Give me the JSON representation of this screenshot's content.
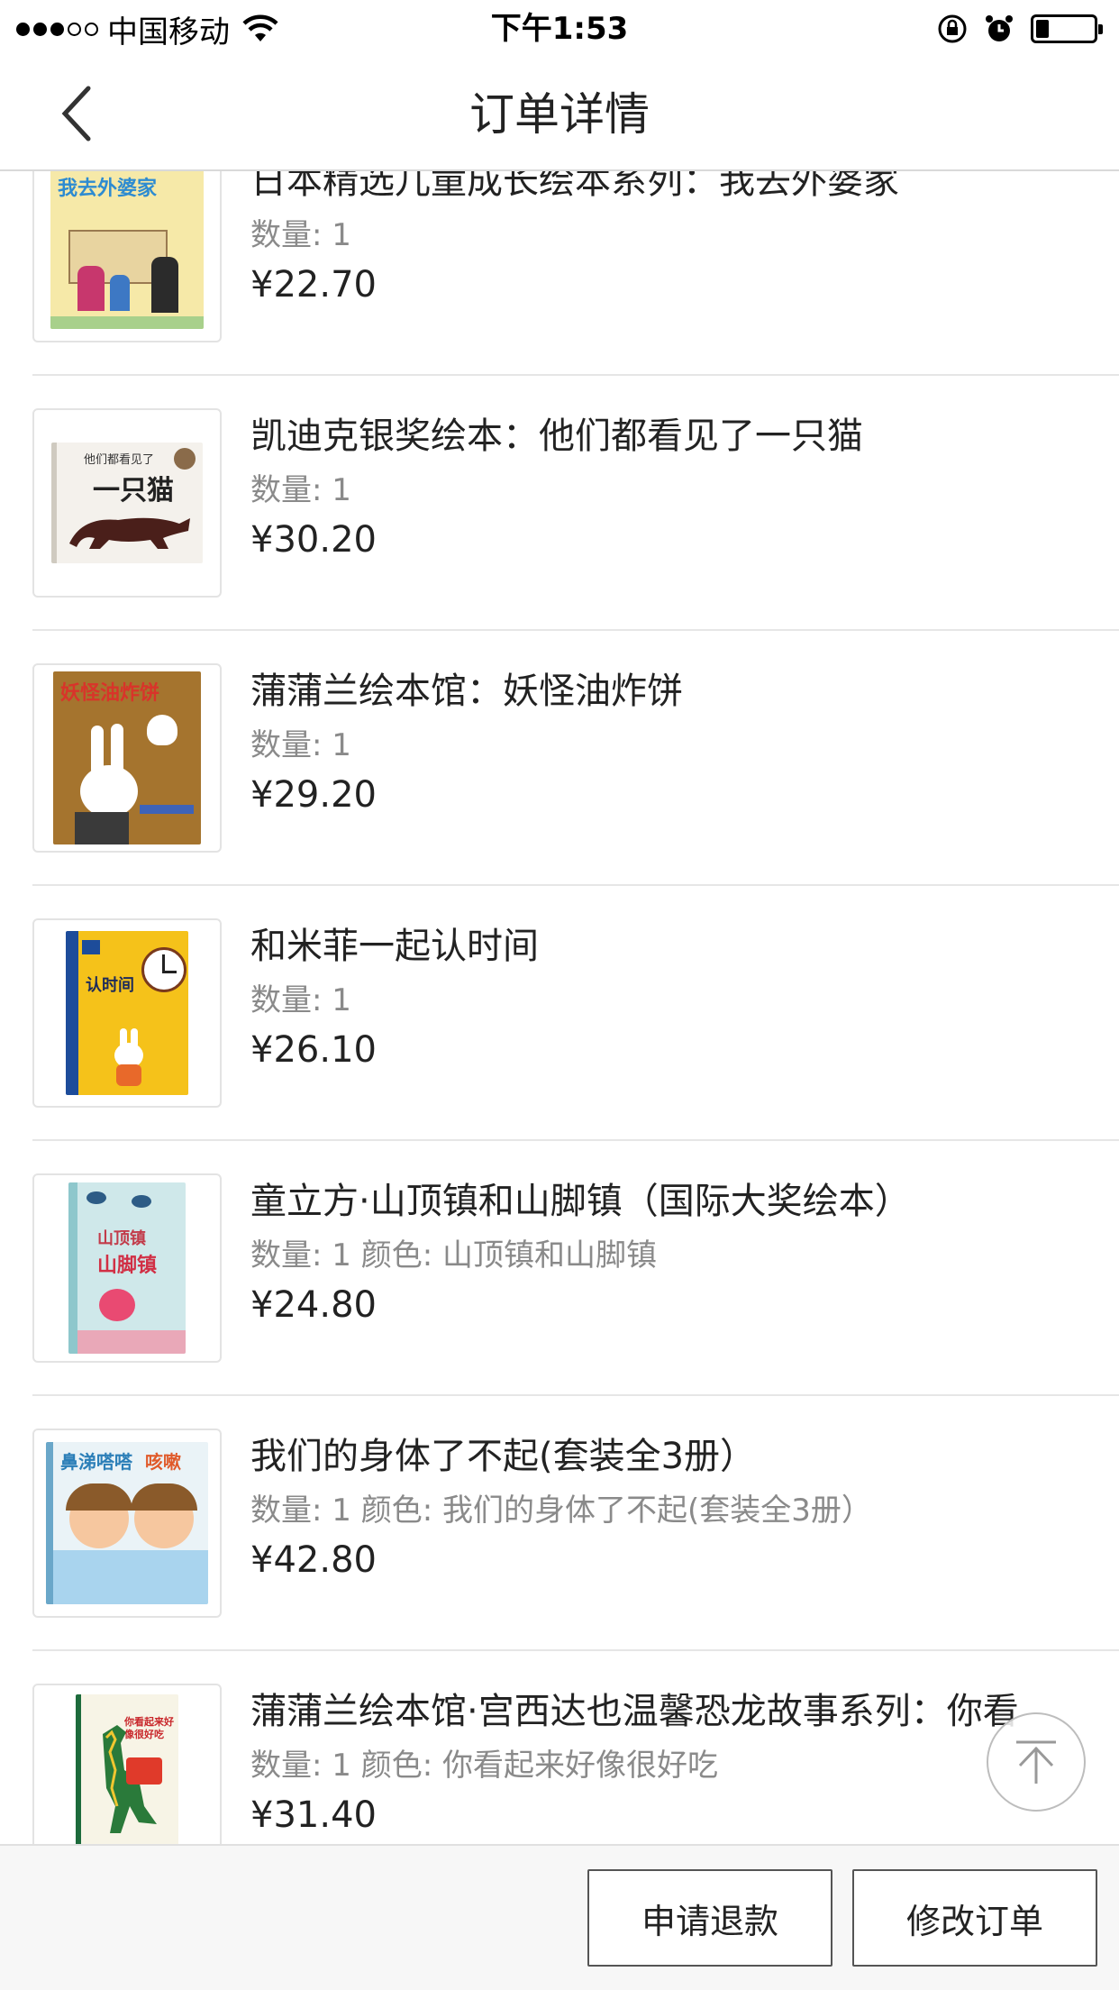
{
  "status_bar": {
    "carrier": "中国移动",
    "time": "下午1:53"
  },
  "nav": {
    "title": "订单详情",
    "back_icon": "chevron-left-icon"
  },
  "items": [
    {
      "title": "日本精选儿童成长绘本系列：我去外婆家",
      "meta": "数量: 1",
      "price": "¥22.70",
      "cover_text": "我去外婆家",
      "cover_color": "#f6e9a8"
    },
    {
      "title": "凯迪克银奖绘本：他们都看见了一只猫",
      "meta": "数量: 1",
      "price": "¥30.20",
      "cover_text": "一只猫",
      "cover_color": "#f4f1ec"
    },
    {
      "title": "蒲蒲兰绘本馆：妖怪油炸饼",
      "meta": "数量: 1",
      "price": "¥29.20",
      "cover_text": "妖怪油炸饼",
      "cover_color": "#a5742e"
    },
    {
      "title": "和米菲一起认时间",
      "meta": "数量: 1",
      "price": "¥26.10",
      "cover_text": "认时间",
      "cover_color": "#f5c21a"
    },
    {
      "title": "童立方·山顶镇和山脚镇（国际大奖绘本）",
      "meta": "数量: 1 颜色: 山顶镇和山脚镇",
      "price": "¥24.80",
      "cover_text": "山脚镇",
      "cover_color": "#cfe8ea"
    },
    {
      "title": "我们的身体了不起(套装全3册）",
      "meta": "数量: 1 颜色: 我们的身体了不起(套装全3册）",
      "price": "¥42.80",
      "cover_text": "鼻涕嗒嗒",
      "cover_color": "#eaf3f7"
    },
    {
      "title": "蒲蒲兰绘本馆·宫西达也温馨恐龙故事系列：你看起来好像很好吃",
      "meta": "数量: 1 颜色: 你看起来好像很好吃",
      "price": "¥31.40",
      "cover_text": "你看起来好像很好吃",
      "cover_color": "#f7f4e6"
    }
  ],
  "floating": {
    "to_top_icon": "arrow-up-icon"
  },
  "bottom": {
    "refund_label": "申请退款",
    "modify_label": "修改订单"
  }
}
